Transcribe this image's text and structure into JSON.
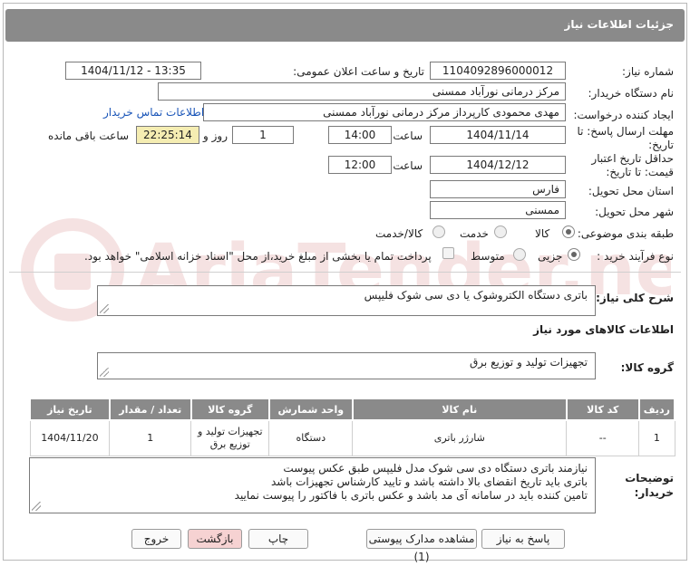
{
  "header": {
    "title": "جزئیات اطلاعات نیاز"
  },
  "fields": {
    "need_number": {
      "label": "شماره نیاز:",
      "value": "1104092896000012"
    },
    "announce_datetime": {
      "label": "تاریخ و ساعت اعلان عمومی:",
      "value": "1404/11/12 - 13:35"
    },
    "buyer_org": {
      "label": "نام دستگاه خریدار:",
      "value": "مرکز درمانی نورآباد ممسنی"
    },
    "requester": {
      "label": "ایجاد کننده درخواست:",
      "value": "مهدی  محمودی کارپرداز مرکز درمانی نورآباد ممسنی",
      "contact_link": "اطلاعات تماس خریدار"
    },
    "reply_deadline": {
      "label_line1": "مهلت ارسال پاسخ: تا",
      "label_line2": "تاریخ:",
      "date": "1404/11/14",
      "time_label": "ساعت",
      "time": "14:00",
      "days": "1",
      "days_label": "روز و",
      "remaining": "22:25:14",
      "remaining_label": "ساعت باقی مانده"
    },
    "price_validity": {
      "label_line1": "حداقل تاریخ اعتبار",
      "label_line2": "قیمت: تا تاریخ:",
      "date": "1404/12/12",
      "time_label": "ساعت",
      "time": "12:00"
    },
    "delivery_province": {
      "label": "استان محل تحویل:",
      "value": "فارس"
    },
    "delivery_city": {
      "label": "شهر محل تحویل:",
      "value": "ممسنی"
    },
    "category": {
      "label": "طبقه بندی موضوعی:",
      "options": [
        "کالا",
        "خدمت",
        "کالا/خدمت"
      ],
      "selected": "کالا"
    },
    "purchase_type": {
      "label": "نوع فرآیند خرید :",
      "options": [
        "جزیی",
        "متوسط"
      ],
      "selected": "جزیی",
      "treasury_note": "پرداخت تمام یا بخشی از مبلغ خرید،از محل \"اسناد خزانه اسلامی\" خواهد بود."
    }
  },
  "summary": {
    "label": "شرح کلی نیاز:",
    "value": "باتری دستگاه الکتروشوک یا دی سی شوک فلیپس"
  },
  "goods_section": {
    "title": "اطلاعات کالاهای مورد نیاز"
  },
  "goods_group": {
    "label": "گروه کالا:",
    "value": "تجهیزات تولید و توزیع برق"
  },
  "table": {
    "headers": [
      "ردیف",
      "کد کالا",
      "نام کالا",
      "واحد شمارش",
      "گروه کالا",
      "تعداد / مقدار",
      "تاریخ نیاز"
    ],
    "rows": [
      {
        "index": "1",
        "code": "--",
        "name": "شارژر باتری",
        "unit": "دستگاه",
        "group_line1": "تجهیزات تولید و",
        "group_line2": "توزیع برق",
        "qty": "1",
        "date": "1404/11/20"
      }
    ]
  },
  "buyer_notes": {
    "label_line1": "توضیحات",
    "label_line2": "خریدار:",
    "lines": [
      "نیازمند باتری دستگاه دی سی شوک مدل فلیپس طبق عکس پیوست",
      "باتری باید تاریخ انقضای بالا داشته باشد و تایید کارشناس تجهیزات باشد",
      "تامین کننده باید در سامانه آی مد باشد و عکس باتری با فاکتور را پیوست نمایید"
    ]
  },
  "buttons": {
    "reply": "پاسخ به نیاز",
    "attachments": "مشاهده مدارک پیوستی (1)",
    "print": "چاپ",
    "back": "بازگشت",
    "exit": "خروج"
  },
  "watermark": {
    "text": "AriaTender.net",
    "color": "#b5282a"
  }
}
